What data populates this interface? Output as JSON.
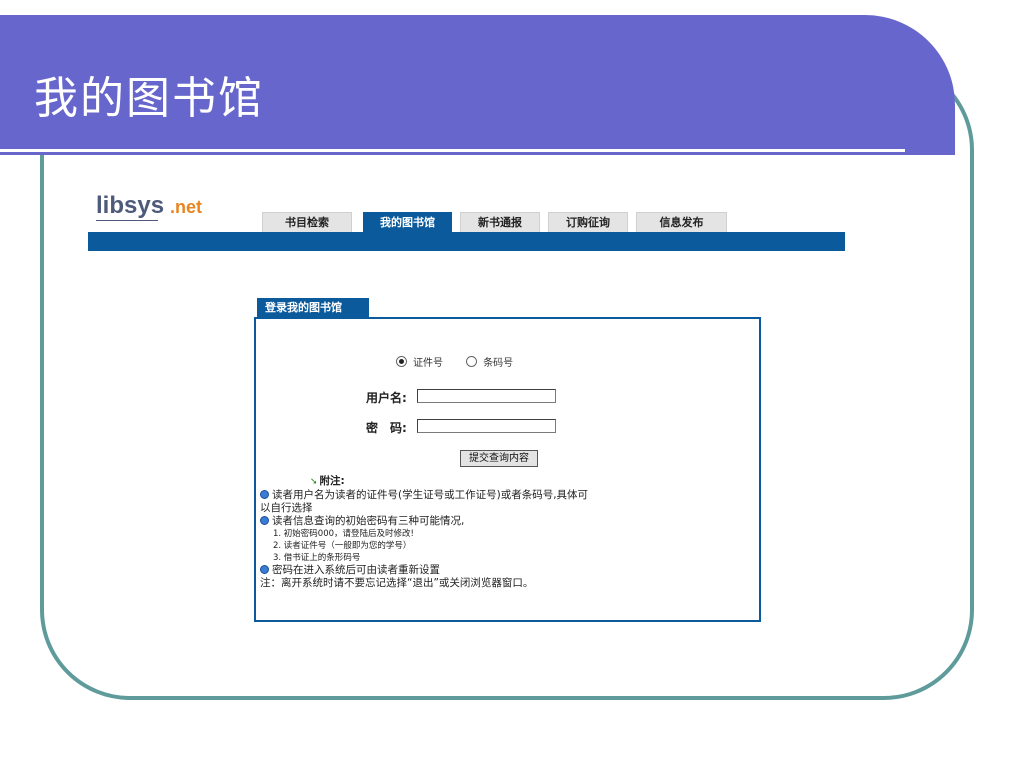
{
  "slide": {
    "title": "我的图书馆"
  },
  "logo": {
    "lib": "libsys",
    "net": ".net"
  },
  "tabs": [
    {
      "label": "书目检索",
      "active": false
    },
    {
      "label": "我的图书馆",
      "active": true
    },
    {
      "label": "新书通报",
      "active": false
    },
    {
      "label": "订购征询",
      "active": false
    },
    {
      "label": "信息发布",
      "active": false
    }
  ],
  "login": {
    "panel_title": "登录我的图书馆",
    "radio_options": [
      "证件号",
      "条码号"
    ],
    "selected_option": "证件号",
    "username_label": "用户名:",
    "password_label": "密　码:",
    "username_value": "",
    "password_value": "",
    "submit_label": "提交查询内容"
  },
  "notes": {
    "header": "附注:",
    "line1a": "读者用户名为读者的证件号(学生证号或工作证号)或者条码号,具体可",
    "line1b": "以自行选择",
    "line2": "读者信息查询的初始密码有三种可能情况,",
    "sub1": "1. 初始密码000，请登陆后及时修改!",
    "sub2": "2. 读者证件号（一般即为您的学号）",
    "sub3": "3. 借书证上的条形码号",
    "line3": "密码在进入系统后可由读者重新设置",
    "footer": "注：离开系统时请不要忘记选择“退出”或关闭浏览器窗口。"
  },
  "colors": {
    "title_band": "#6666cc",
    "frame": "#5f9b9b",
    "nav": "#0b5a9c",
    "logo_net": "#e8851f"
  }
}
